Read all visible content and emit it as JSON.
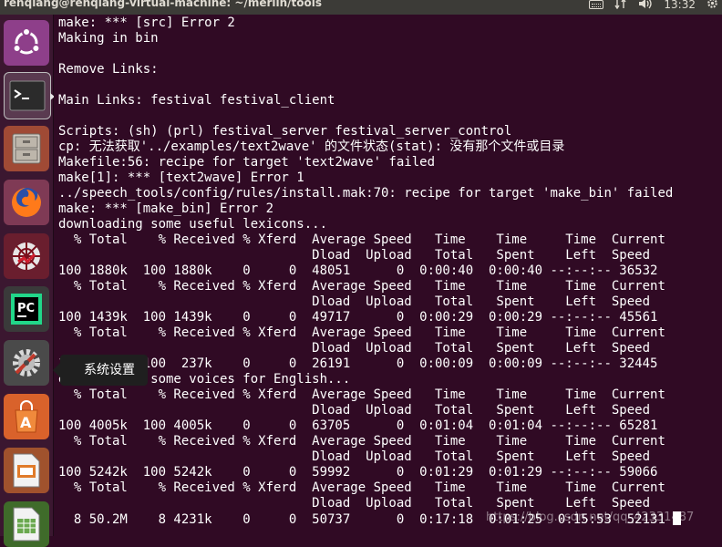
{
  "window": {
    "title": "renqiang@renqiang-virtual-machine: ~/merlin/tools"
  },
  "panel": {
    "time": "13:32",
    "indicators": [
      "keyboard-icon",
      "input-sort-icon",
      "volume-icon",
      "settings-gear-icon"
    ]
  },
  "launcher": {
    "items": [
      {
        "name": "ubuntu-dash-icon"
      },
      {
        "name": "terminal-icon"
      },
      {
        "name": "files-cabinet-icon"
      },
      {
        "name": "firefox-icon"
      },
      {
        "name": "spider-app-icon"
      },
      {
        "name": "pycharm-icon"
      },
      {
        "name": "system-settings-icon"
      },
      {
        "name": "software-center-icon"
      },
      {
        "name": "impress-icon"
      },
      {
        "name": "calc-icon"
      }
    ],
    "tooltip": "系统设置"
  },
  "terminal": {
    "lines": [
      "make: *** [src] Error 2",
      "Making in bin",
      "",
      "Remove Links:",
      "",
      "Main Links: festival festival_client",
      "",
      "Scripts: (sh) (prl) festival_server festival_server_control",
      "cp: 无法获取'../examples/text2wave' 的文件状态(stat): 没有那个文件或目录",
      "Makefile:56: recipe for target 'text2wave' failed",
      "make[1]: *** [text2wave] Error 1",
      "../speech_tools/config/rules/install.mak:70: recipe for target 'make_bin' failed",
      "make: *** [make_bin] Error 2",
      "downloading some useful lexicons...",
      "  % Total    % Received % Xferd  Average Speed   Time    Time     Time  Current",
      "                                 Dload  Upload   Total   Spent    Left  Speed",
      "100 1880k  100 1880k    0     0  48051      0  0:00:40  0:00:40 --:--:-- 36532",
      "  % Total    % Received % Xferd  Average Speed   Time    Time     Time  Current",
      "                                 Dload  Upload   Total   Spent    Left  Speed",
      "100 1439k  100 1439k    0     0  49717      0  0:00:29  0:00:29 --:--:-- 45561",
      "  % Total    % Received % Xferd  Average Speed   Time    Time     Time  Current",
      "                                 Dload  Upload   Total   Spent    Left  Speed",
      "100  237k  100  237k    0     0  26191      0  0:00:09  0:00:09 --:--:-- 32445",
      "downloading some voices for English...",
      "  % Total    % Received % Xferd  Average Speed   Time    Time     Time  Current",
      "                                 Dload  Upload   Total   Spent    Left  Speed",
      "100 4005k  100 4005k    0     0  63705      0  0:01:04  0:01:04 --:--:-- 65281",
      "  % Total    % Received % Xferd  Average Speed   Time    Time     Time  Current",
      "                                 Dload  Upload   Total   Spent    Left  Speed",
      "100 5242k  100 5242k    0     0  59992      0  0:01:29  0:01:29 --:--:-- 59066",
      "  % Total    % Received % Xferd  Average Speed   Time    Time     Time  Current",
      "                                 Dload  Upload   Total   Spent    Left  Speed",
      "  8 50.2M    8 4231k    0     0  50737      0  0:17:18  0:01:25  0:15:53  52131"
    ]
  },
  "watermark": "https://blog.csdn.net/qq_42331487",
  "colors": {
    "terminal_bg": "#300a24",
    "terminal_fg": "#ffffff",
    "panel_bg": "#3c3b37",
    "launcher_bg": "#3b1730"
  }
}
